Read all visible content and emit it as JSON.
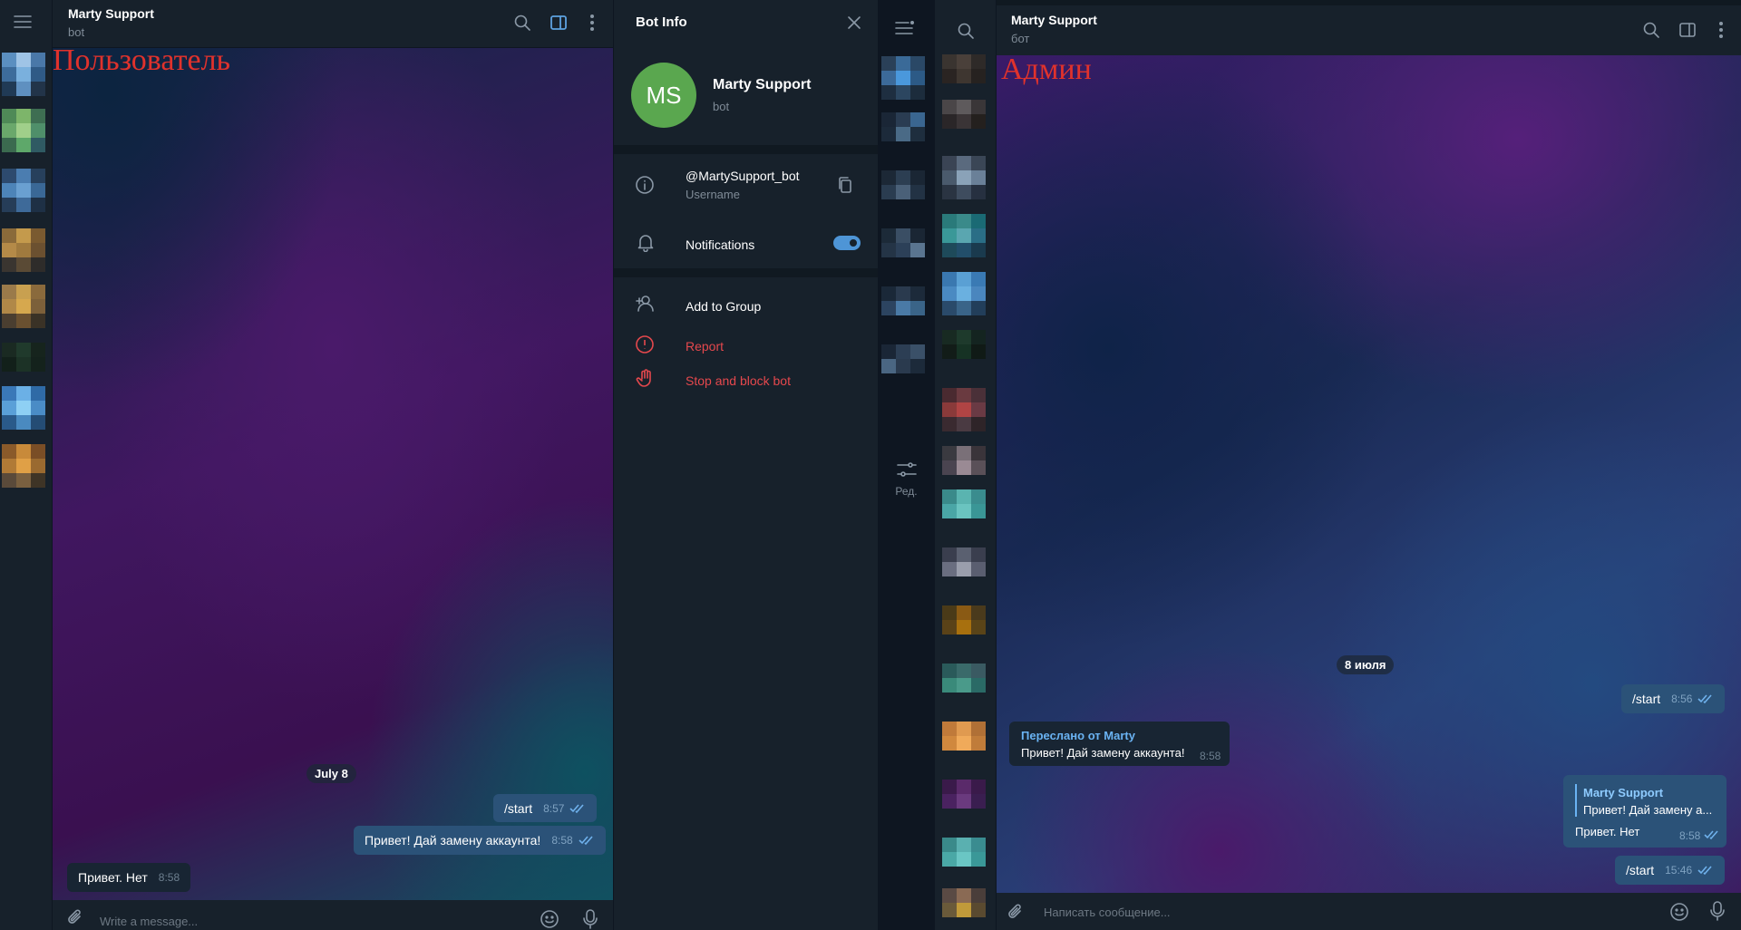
{
  "left": {
    "header": {
      "title": "Marty Support",
      "subtitle": "bot"
    },
    "overlay_label": "Пользователь",
    "date_pill": "July 8",
    "messages": [
      {
        "text": "/start",
        "time": "8:57"
      },
      {
        "text": "Привет! Дай замену аккаунта!",
        "time": "8:58"
      },
      {
        "text": "Привет. Нет",
        "time": "8:58"
      }
    ],
    "composer_placeholder": "Write a message..."
  },
  "bot_info": {
    "title": "Bot Info",
    "avatar_initials": "MS",
    "avatar_color": "#5aa74f",
    "name": "Marty Support",
    "status": "bot",
    "username": "@MartySupport_bot",
    "username_label": "Username",
    "notifications_label": "Notifications",
    "notifications_on": true,
    "add_to_group": "Add to Group",
    "report": "Report",
    "stop_block": "Stop and block bot",
    "danger_color": "#e5484d"
  },
  "folders": {
    "edit_label": "Ред."
  },
  "right": {
    "header": {
      "title": "Marty Support",
      "subtitle": "бот"
    },
    "overlay_label": "Админ",
    "date_pill": "8 июля",
    "messages": [
      {
        "text": "/start",
        "time": "8:56"
      },
      {
        "forward_from": "Переслано от Marty",
        "text": "Привет! Дай замену аккаунта!",
        "time": "8:58"
      },
      {
        "reply_name": "Marty Support",
        "reply_text": "Привет! Дай замену а...",
        "text": "Привет. Нет",
        "time": "8:58"
      },
      {
        "text": "/start",
        "time": "15:46"
      }
    ],
    "composer_placeholder": "Написать сообщение..."
  }
}
